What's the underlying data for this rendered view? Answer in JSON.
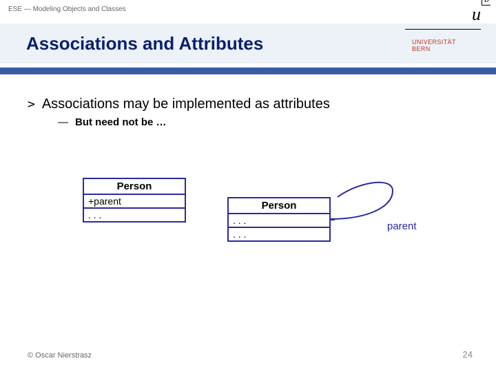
{
  "header": {
    "breadcrumb": "ESE — Modeling Objects and Classes"
  },
  "title": "Associations and Attributes",
  "logo": {
    "u": "u",
    "b": "b",
    "line1": "UNIVERSITÄT",
    "line2": "BERN"
  },
  "bullets": {
    "level1": {
      "marker": ">",
      "text": "Associations may be implemented as attributes"
    },
    "level2": {
      "marker": "—",
      "text": "But need not be …"
    }
  },
  "diagram": {
    "left": {
      "name": "Person",
      "attribute": "+parent",
      "ops": ". . ."
    },
    "right": {
      "name": "Person",
      "attrs": ". . .",
      "ops": ". . ."
    },
    "association": {
      "role": "parent"
    }
  },
  "footer": {
    "copyright": "© Oscar Nierstrasz",
    "page": "24"
  },
  "colors": {
    "title_text": "#0a1f6e",
    "accent_bar": "#3b5ba5",
    "title_band_bg": "#edf2f8",
    "uml_border": "#2a2aa4",
    "uni_label": "#c4302b"
  }
}
